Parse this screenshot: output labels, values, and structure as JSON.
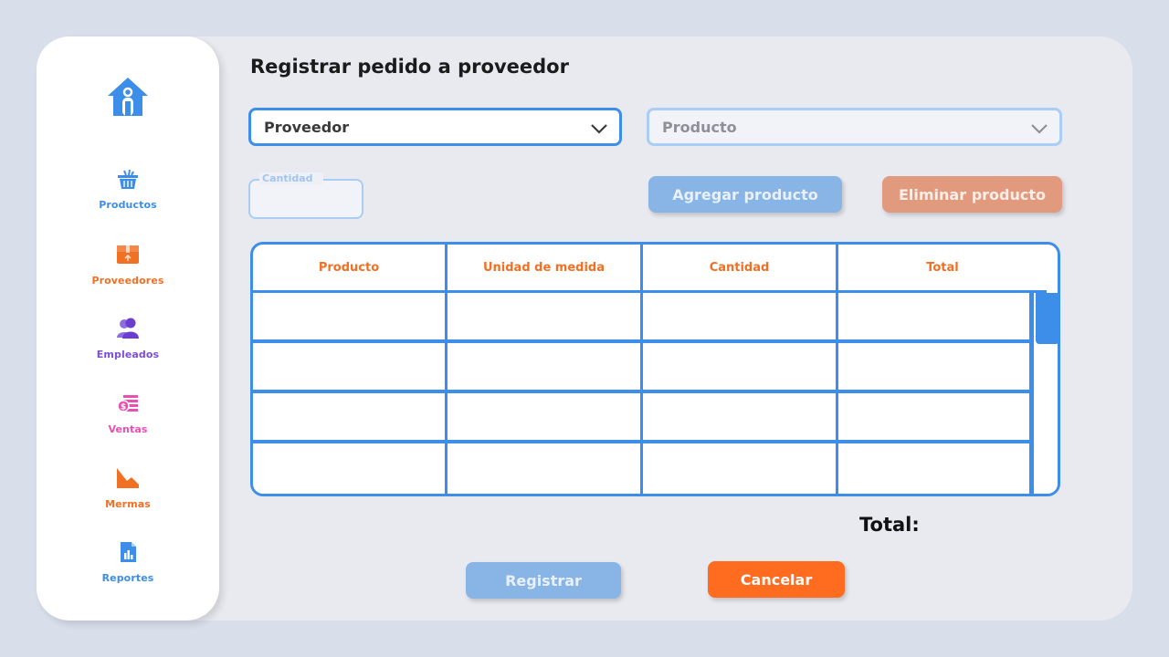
{
  "page": {
    "title": "Registrar pedido a proveedor"
  },
  "sidebar": {
    "home_icon": "home-icon",
    "items": [
      {
        "label": "Productos",
        "icon": "basket-icon",
        "color": "#3d8ee8"
      },
      {
        "label": "Proveedores",
        "icon": "box-icon",
        "color": "#f07024"
      },
      {
        "label": "Empleados",
        "icon": "people-icon",
        "color": "#7b4fd6"
      },
      {
        "label": "Ventas",
        "icon": "money-icon",
        "color": "#e94fb0"
      },
      {
        "label": "Mermas",
        "icon": "decline-chart-icon",
        "color": "#f07024"
      },
      {
        "label": "Reportes",
        "icon": "report-icon",
        "color": "#3d8ee8"
      }
    ]
  },
  "form": {
    "proveedor_select": {
      "value": "Proveedor"
    },
    "producto_select": {
      "value": "Producto"
    },
    "cantidad_field": {
      "label": "Cantidad",
      "value": ""
    },
    "agregar_button": "Agregar producto",
    "eliminar_button": "Eliminar producto"
  },
  "table": {
    "columns": [
      "Producto",
      "Unidad de medida",
      "Cantidad",
      "Total"
    ],
    "rows": [
      [
        "",
        "",
        "",
        ""
      ],
      [
        "",
        "",
        "",
        ""
      ],
      [
        "",
        "",
        "",
        ""
      ],
      [
        "",
        "",
        "",
        ""
      ]
    ]
  },
  "summary": {
    "total_label": "Total:"
  },
  "actions": {
    "registrar_button": "Registrar",
    "cancelar_button": "Cancelar"
  },
  "colors": {
    "primary_blue": "#3d8ee8",
    "accent_orange": "#ff6b1f",
    "disabled_blue": "#89b4e6",
    "disabled_orange": "#e29a7e"
  }
}
